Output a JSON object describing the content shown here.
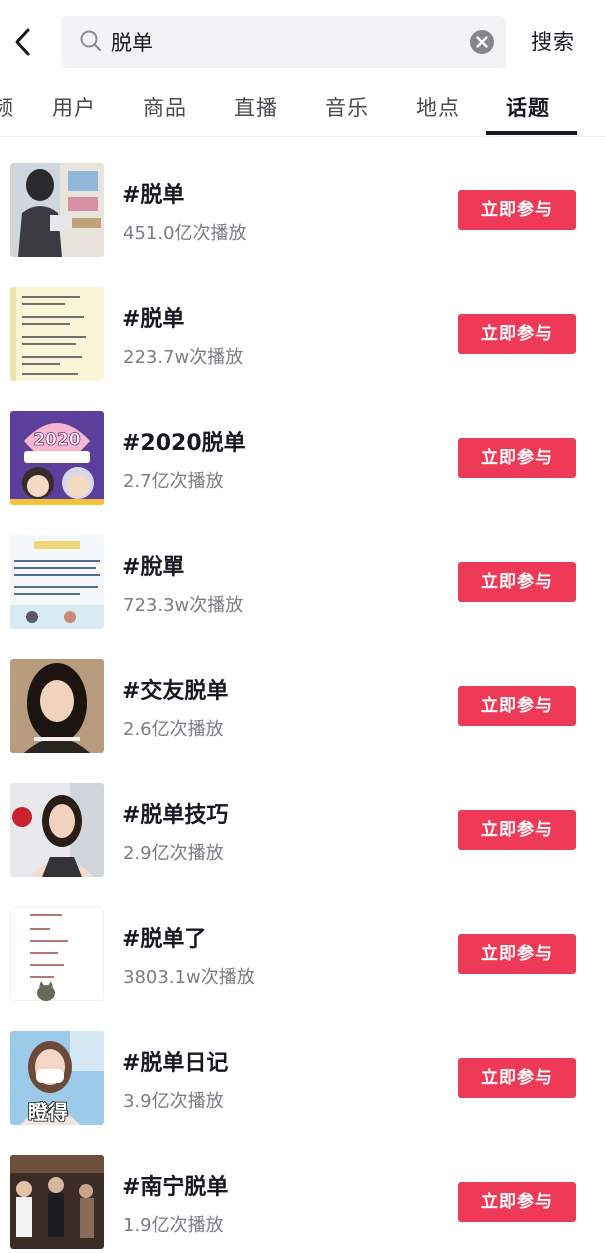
{
  "search": {
    "value": "脱单",
    "button_label": "搜索"
  },
  "tabs": [
    {
      "label": "频"
    },
    {
      "label": "用户"
    },
    {
      "label": "商品"
    },
    {
      "label": "直播"
    },
    {
      "label": "音乐"
    },
    {
      "label": "地点"
    },
    {
      "label": "话题",
      "active": true
    }
  ],
  "topics": [
    {
      "title": "#脱单",
      "plays": "451.0亿次播放",
      "button": "立即参与"
    },
    {
      "title": "#脱单",
      "plays": "223.7w次播放",
      "button": "立即参与"
    },
    {
      "title": "#2020脱单",
      "plays": "2.7亿次播放",
      "button": "立即参与"
    },
    {
      "title": "#脫單",
      "plays": "723.3w次播放",
      "button": "立即参与"
    },
    {
      "title": "#交友脱单",
      "plays": "2.6亿次播放",
      "button": "立即参与"
    },
    {
      "title": "#脱单技巧",
      "plays": "2.9亿次播放",
      "button": "立即参与"
    },
    {
      "title": "#脱单了",
      "plays": "3803.1w次播放",
      "button": "立即参与"
    },
    {
      "title": "#脱单日记",
      "plays": "3.9亿次播放",
      "button": "立即参与"
    },
    {
      "title": "#南宁脱单",
      "plays": "1.9亿次播放",
      "button": "立即参与"
    }
  ],
  "thumbnails": [
    {
      "icon": "photo-thumbnail-woman-shopping"
    },
    {
      "icon": "text-note-thumbnail"
    },
    {
      "icon": "cartoon-thumbnail-2020",
      "text": "2020"
    },
    {
      "icon": "text-card-thumbnail"
    },
    {
      "icon": "portrait-thumbnail-woman"
    },
    {
      "icon": "portrait-thumbnail-woman"
    },
    {
      "icon": "text-note-thumbnail"
    },
    {
      "icon": "portrait-thumbnail-masked",
      "text": "瞪得"
    },
    {
      "icon": "street-photo-thumbnail"
    }
  ],
  "colors": {
    "accent": "#ee3a57",
    "text_primary": "#161823",
    "text_secondary": "#7c7c82",
    "search_bg": "#f3f3f5"
  }
}
